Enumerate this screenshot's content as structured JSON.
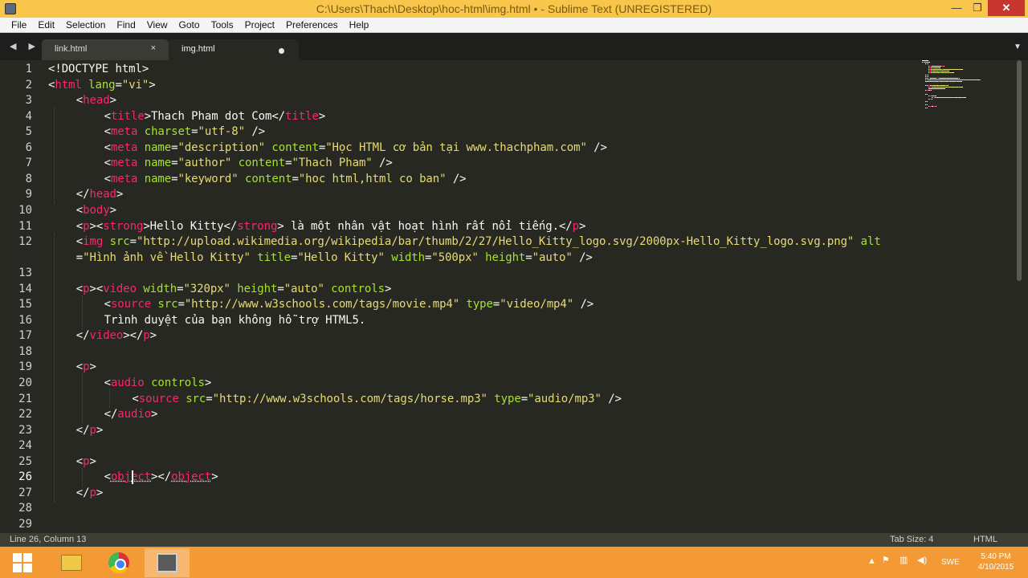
{
  "window": {
    "title": "C:\\Users\\Thach\\Desktop\\hoc-html\\img.html • - Sublime Text (UNREGISTERED)",
    "min_glyph": "—",
    "max_glyph": "❐",
    "close_glyph": "✕"
  },
  "menu": [
    "File",
    "Edit",
    "Selection",
    "Find",
    "View",
    "Goto",
    "Tools",
    "Project",
    "Preferences",
    "Help"
  ],
  "tabs": [
    {
      "label": "link.html",
      "close": "×"
    },
    {
      "label": "img.html"
    }
  ],
  "nav_arrows": "◀ ▶",
  "tab_overflow": "▼",
  "editor": {
    "active_line": 26,
    "lines": [
      [
        [
          "tx",
          "<!DOCTYPE html>"
        ]
      ],
      [
        [
          "tx",
          "<"
        ],
        [
          "tg",
          "html"
        ],
        [
          "tx",
          " "
        ],
        [
          "at",
          "lang"
        ],
        [
          "tx",
          "="
        ],
        [
          "st",
          "\"vi\""
        ],
        [
          "tx",
          ">"
        ]
      ],
      [
        [
          "tx",
          "<"
        ],
        [
          "tg",
          "head"
        ],
        [
          "tx",
          ">"
        ]
      ],
      [
        [
          "tx",
          "<"
        ],
        [
          "tg",
          "title"
        ],
        [
          "tx",
          ">Thach Pham dot Com</"
        ],
        [
          "tg",
          "title"
        ],
        [
          "tx",
          ">"
        ]
      ],
      [
        [
          "tx",
          "<"
        ],
        [
          "tg",
          "meta"
        ],
        [
          "tx",
          " "
        ],
        [
          "at",
          "charset"
        ],
        [
          "tx",
          "="
        ],
        [
          "st",
          "\"utf-8\""
        ],
        [
          "tx",
          " />"
        ]
      ],
      [
        [
          "tx",
          "<"
        ],
        [
          "tg",
          "meta"
        ],
        [
          "tx",
          " "
        ],
        [
          "at",
          "name"
        ],
        [
          "tx",
          "="
        ],
        [
          "st",
          "\"description\""
        ],
        [
          "tx",
          " "
        ],
        [
          "at",
          "content"
        ],
        [
          "tx",
          "="
        ],
        [
          "st",
          "\"Học HTML cơ bản tại www.thachpham.com\""
        ],
        [
          "tx",
          " />"
        ]
      ],
      [
        [
          "tx",
          "<"
        ],
        [
          "tg",
          "meta"
        ],
        [
          "tx",
          " "
        ],
        [
          "at",
          "name"
        ],
        [
          "tx",
          "="
        ],
        [
          "st",
          "\"author\""
        ],
        [
          "tx",
          " "
        ],
        [
          "at",
          "content"
        ],
        [
          "tx",
          "="
        ],
        [
          "st",
          "\"Thach Pham\""
        ],
        [
          "tx",
          " />"
        ]
      ],
      [
        [
          "tx",
          "<"
        ],
        [
          "tg",
          "meta"
        ],
        [
          "tx",
          " "
        ],
        [
          "at",
          "name"
        ],
        [
          "tx",
          "="
        ],
        [
          "st",
          "\"keyword\""
        ],
        [
          "tx",
          " "
        ],
        [
          "at",
          "content"
        ],
        [
          "tx",
          "="
        ],
        [
          "st",
          "\"hoc html,html co ban\""
        ],
        [
          "tx",
          " />"
        ]
      ],
      [
        [
          "tx",
          "</"
        ],
        [
          "tg",
          "head"
        ],
        [
          "tx",
          ">"
        ]
      ],
      [
        [
          "tx",
          "<"
        ],
        [
          "tg",
          "body"
        ],
        [
          "tx",
          ">"
        ]
      ],
      [
        [
          "tx",
          "<"
        ],
        [
          "tg",
          "p"
        ],
        [
          "tx",
          "><"
        ],
        [
          "tg",
          "strong"
        ],
        [
          "tx",
          ">Hello Kitty</"
        ],
        [
          "tg",
          "strong"
        ],
        [
          "tx",
          "> là một nhân vật hoạt hình rất nổi tiếng.</"
        ],
        [
          "tg",
          "p"
        ],
        [
          "tx",
          ">"
        ]
      ],
      [
        [
          "tx",
          "<"
        ],
        [
          "tg",
          "img"
        ],
        [
          "tx",
          " "
        ],
        [
          "at",
          "src"
        ],
        [
          "tx",
          "="
        ],
        [
          "st",
          "\"http://upload.wikimedia.org/wikipedia/bar/thumb/2/27/Hello_Kitty_logo.svg/2000px-Hello_Kitty_logo.svg.png\""
        ],
        [
          "tx",
          " "
        ],
        [
          "at",
          "alt"
        ]
      ],
      [
        [
          "tx",
          "="
        ],
        [
          "st",
          "\"Hình ảnh về Hello Kitty\""
        ],
        [
          "tx",
          " "
        ],
        [
          "at",
          "title"
        ],
        [
          "tx",
          "="
        ],
        [
          "st",
          "\"Hello Kitty\""
        ],
        [
          "tx",
          " "
        ],
        [
          "at",
          "width"
        ],
        [
          "tx",
          "="
        ],
        [
          "st",
          "\"500px\""
        ],
        [
          "tx",
          " "
        ],
        [
          "at",
          "height"
        ],
        [
          "tx",
          "="
        ],
        [
          "st",
          "\"auto\""
        ],
        [
          "tx",
          " />"
        ]
      ],
      [],
      [
        [
          "tx",
          "<"
        ],
        [
          "tg",
          "p"
        ],
        [
          "tx",
          "><"
        ],
        [
          "tg",
          "video"
        ],
        [
          "tx",
          " "
        ],
        [
          "at",
          "width"
        ],
        [
          "tx",
          "="
        ],
        [
          "st",
          "\"320px\""
        ],
        [
          "tx",
          " "
        ],
        [
          "at",
          "height"
        ],
        [
          "tx",
          "="
        ],
        [
          "st",
          "\"auto\""
        ],
        [
          "tx",
          " "
        ],
        [
          "at",
          "controls"
        ],
        [
          "tx",
          ">"
        ]
      ],
      [
        [
          "tx",
          "<"
        ],
        [
          "tg",
          "source"
        ],
        [
          "tx",
          " "
        ],
        [
          "at",
          "src"
        ],
        [
          "tx",
          "="
        ],
        [
          "st",
          "\"http://www.w3schools.com/tags/movie.mp4\""
        ],
        [
          "tx",
          " "
        ],
        [
          "at",
          "type"
        ],
        [
          "tx",
          "="
        ],
        [
          "st",
          "\"video/mp4\""
        ],
        [
          "tx",
          " />"
        ]
      ],
      [
        [
          "tx",
          "Trình duyệt của bạn không hỗ trợ HTML5."
        ]
      ],
      [
        [
          "tx",
          "</"
        ],
        [
          "tg",
          "video"
        ],
        [
          "tx",
          "></"
        ],
        [
          "tg",
          "p"
        ],
        [
          "tx",
          ">"
        ]
      ],
      [],
      [
        [
          "tx",
          "<"
        ],
        [
          "tg",
          "p"
        ],
        [
          "tx",
          ">"
        ]
      ],
      [
        [
          "tx",
          "<"
        ],
        [
          "tg",
          "audio"
        ],
        [
          "tx",
          " "
        ],
        [
          "at",
          "controls"
        ],
        [
          "tx",
          ">"
        ]
      ],
      [
        [
          "tx",
          "<"
        ],
        [
          "tg",
          "source"
        ],
        [
          "tx",
          " "
        ],
        [
          "at",
          "src"
        ],
        [
          "tx",
          "="
        ],
        [
          "st",
          "\"http://www.w3schools.com/tags/horse.mp3\""
        ],
        [
          "tx",
          " "
        ],
        [
          "at",
          "type"
        ],
        [
          "tx",
          "="
        ],
        [
          "st",
          "\"audio/mp3\""
        ],
        [
          "tx",
          " />"
        ]
      ],
      [
        [
          "tx",
          "</"
        ],
        [
          "tg",
          "audio"
        ],
        [
          "tx",
          ">"
        ]
      ],
      [
        [
          "tx",
          "</"
        ],
        [
          "tg",
          "p"
        ],
        [
          "tx",
          ">"
        ]
      ],
      [],
      [
        [
          "tx",
          "<"
        ],
        [
          "tg",
          "p"
        ],
        [
          "tx",
          ">"
        ]
      ],
      [
        [
          "tx",
          "<"
        ],
        [
          "tg",
          "object"
        ],
        [
          "tx",
          "></"
        ],
        [
          "tg",
          "object"
        ],
        [
          "tx",
          ">"
        ]
      ],
      [
        [
          "tx",
          "</"
        ],
        [
          "tg",
          "p"
        ],
        [
          "tx",
          ">"
        ]
      ],
      [],
      []
    ],
    "line_numbers": [
      "1",
      "2",
      "3",
      "4",
      "5",
      "6",
      "7",
      "8",
      "9",
      "10",
      "11",
      "12",
      "",
      "13",
      "14",
      "15",
      "16",
      "17",
      "18",
      "19",
      "20",
      "21",
      "22",
      "23",
      "24",
      "25",
      "26",
      "27",
      "28",
      "29"
    ]
  },
  "statusbar": {
    "position": "Line 26, Column 13",
    "tab_size": "Tab Size: 4",
    "syntax": "HTML"
  },
  "taskbar": {
    "apps": [
      "file-explorer",
      "chrome",
      "sublime-text"
    ],
    "tray_lang": "SWE",
    "time": "5:40 PM",
    "date": "4/10/2015"
  },
  "colors": {
    "editor_bg": "#272822",
    "tag": "#f92672",
    "attr": "#a6e22e",
    "string": "#e6db74",
    "text": "#f8f8f2",
    "titlebar": "#f7c64a",
    "taskbar": "#f39a34"
  }
}
